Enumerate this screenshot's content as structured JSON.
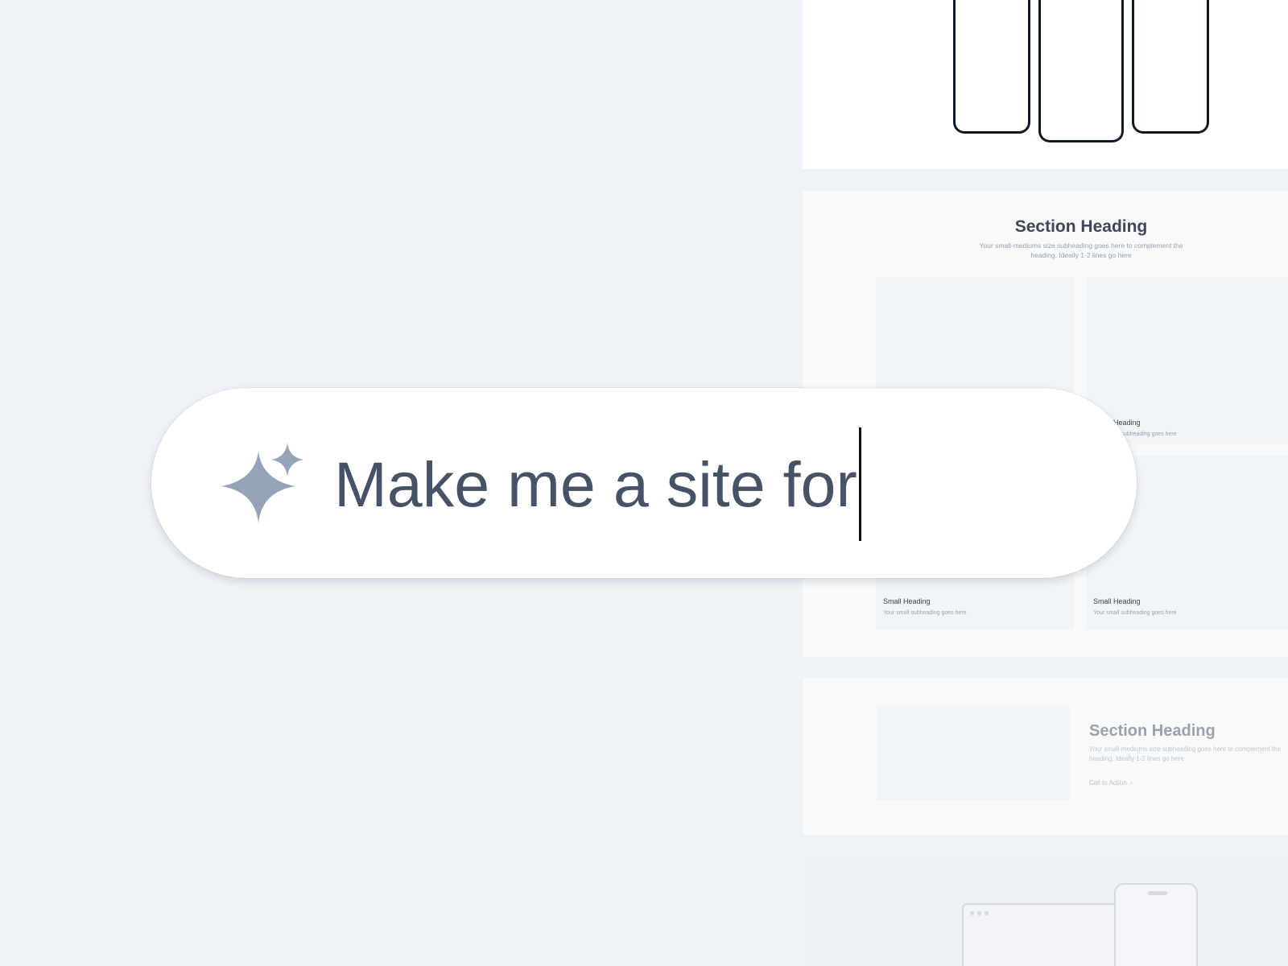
{
  "prompt": {
    "value": "Make me a site for",
    "icon": "sparkle-icon",
    "icon_color": "#94a3b8",
    "text_color": "#465366"
  },
  "features_section": {
    "heading": "Section Heading",
    "subheading": "Your small-mediums size subheading goes here to complement the heading. Ideally 1-2 lines go here",
    "cards": [
      {
        "heading": "",
        "subheading": ""
      },
      {
        "heading": "Small Heading",
        "subheading": "Your small subheading goes here"
      },
      {
        "heading": "Small Heading",
        "subheading": "Your small subheading goes here"
      },
      {
        "heading": "Small Heading",
        "subheading": "Your small subheading goes here"
      }
    ]
  },
  "split_section": {
    "heading": "Section Heading",
    "subheading": "Your small-mediums size subheading goes here to complement the heading. Ideally 1-2 lines go here",
    "cta": "Call to Action",
    "cta_icon": "chevron-right-icon"
  },
  "colors": {
    "background": "#eff2f7",
    "panel": "#f7f9fb",
    "card": "#f1f4f8"
  }
}
